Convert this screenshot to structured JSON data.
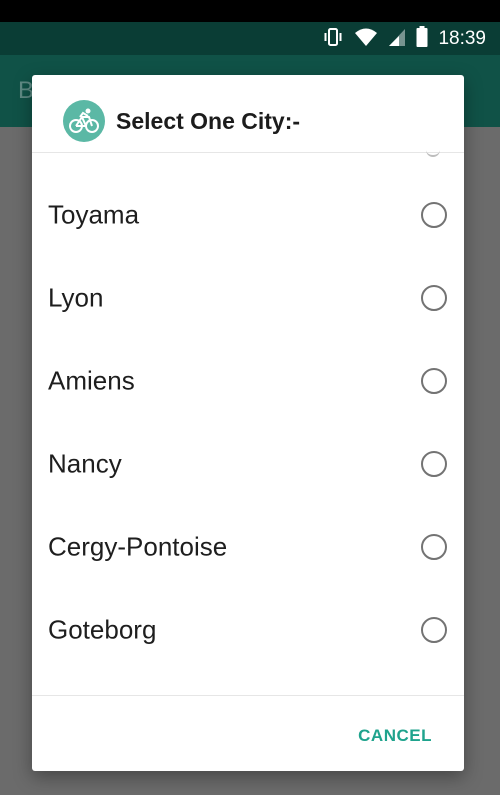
{
  "status_bar": {
    "time": "18:39",
    "icons": [
      "vibrate-icon",
      "wifi-icon",
      "signal-icon",
      "battery-icon"
    ]
  },
  "app_bar": {
    "title": "B"
  },
  "dialog": {
    "icon": "bicycle-icon",
    "title": "Select One City:-",
    "items": [
      {
        "label": "Toyama",
        "selected": false
      },
      {
        "label": "Lyon",
        "selected": false
      },
      {
        "label": "Amiens",
        "selected": false
      },
      {
        "label": "Nancy",
        "selected": false
      },
      {
        "label": "Cergy-Pontoise",
        "selected": false
      },
      {
        "label": "Goteborg",
        "selected": false
      }
    ],
    "cancel_label": "CANCEL"
  },
  "colors": {
    "accent": "#1fa38d",
    "icon_bg": "#5bb8a5",
    "app_bar": "#105247",
    "scrim": "#6b6b6b"
  }
}
